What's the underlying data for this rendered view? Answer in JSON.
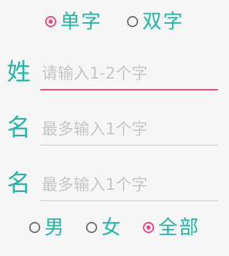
{
  "name_length": {
    "options": [
      {
        "label": "单字",
        "checked": true
      },
      {
        "label": "双字",
        "checked": false
      }
    ]
  },
  "fields": {
    "surname": {
      "prefix": "姓",
      "placeholder": "请输入1-2个字",
      "value": ""
    },
    "given_name_1": {
      "prefix": "名",
      "placeholder": "最多输入1个字",
      "value": ""
    },
    "given_name_2": {
      "prefix": "名",
      "placeholder": "最多输入1个字",
      "value": ""
    }
  },
  "gender": {
    "options": [
      {
        "label": "男",
        "checked": false
      },
      {
        "label": "女",
        "checked": false
      },
      {
        "label": "全部",
        "checked": true
      }
    ]
  },
  "colors": {
    "accent": "#f43f7c",
    "text_teal": "#22b6a8",
    "background": "#f6f6f6"
  }
}
